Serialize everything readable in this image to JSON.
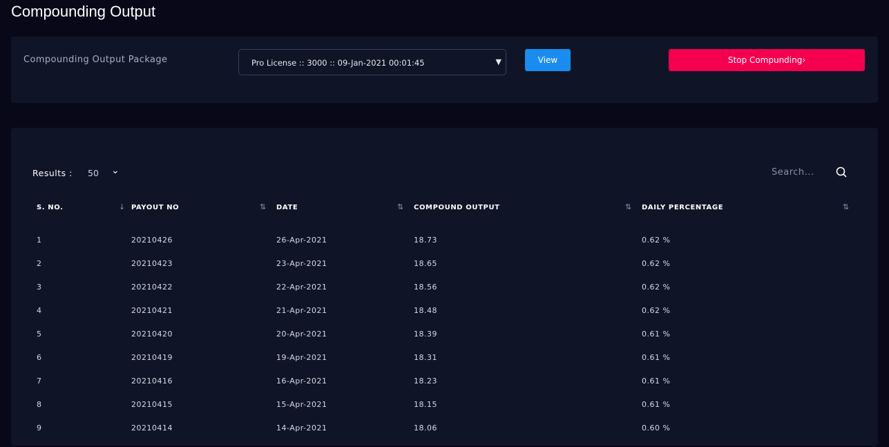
{
  "page": {
    "title": "Compounding Output"
  },
  "package": {
    "label": "Compounding Output Package",
    "selected": "Pro License :: 3000 :: 09-Jan-2021 00:01:45",
    "view_label": "View",
    "stop_label": "Stop Compunding›"
  },
  "table": {
    "results_label": "Results :",
    "results_value": "50",
    "search_placeholder": "Search...",
    "columns": [
      "S. NO.",
      "PAYOUT NO",
      "DATE",
      "COMPOUND OUTPUT",
      "DAILY PERCENTAGE"
    ],
    "rows": [
      [
        "1",
        "20210426",
        "26-Apr-2021",
        "18.73",
        "0.62 %"
      ],
      [
        "2",
        "20210423",
        "23-Apr-2021",
        "18.65",
        "0.62 %"
      ],
      [
        "3",
        "20210422",
        "22-Apr-2021",
        "18.56",
        "0.62 %"
      ],
      [
        "4",
        "20210421",
        "21-Apr-2021",
        "18.48",
        "0.62 %"
      ],
      [
        "5",
        "20210420",
        "20-Apr-2021",
        "18.39",
        "0.61 %"
      ],
      [
        "6",
        "20210419",
        "19-Apr-2021",
        "18.31",
        "0.61 %"
      ],
      [
        "7",
        "20210416",
        "16-Apr-2021",
        "18.23",
        "0.61 %"
      ],
      [
        "8",
        "20210415",
        "15-Apr-2021",
        "18.15",
        "0.61 %"
      ],
      [
        "9",
        "20210414",
        "14-Apr-2021",
        "18.06",
        "0.60 %"
      ]
    ]
  }
}
